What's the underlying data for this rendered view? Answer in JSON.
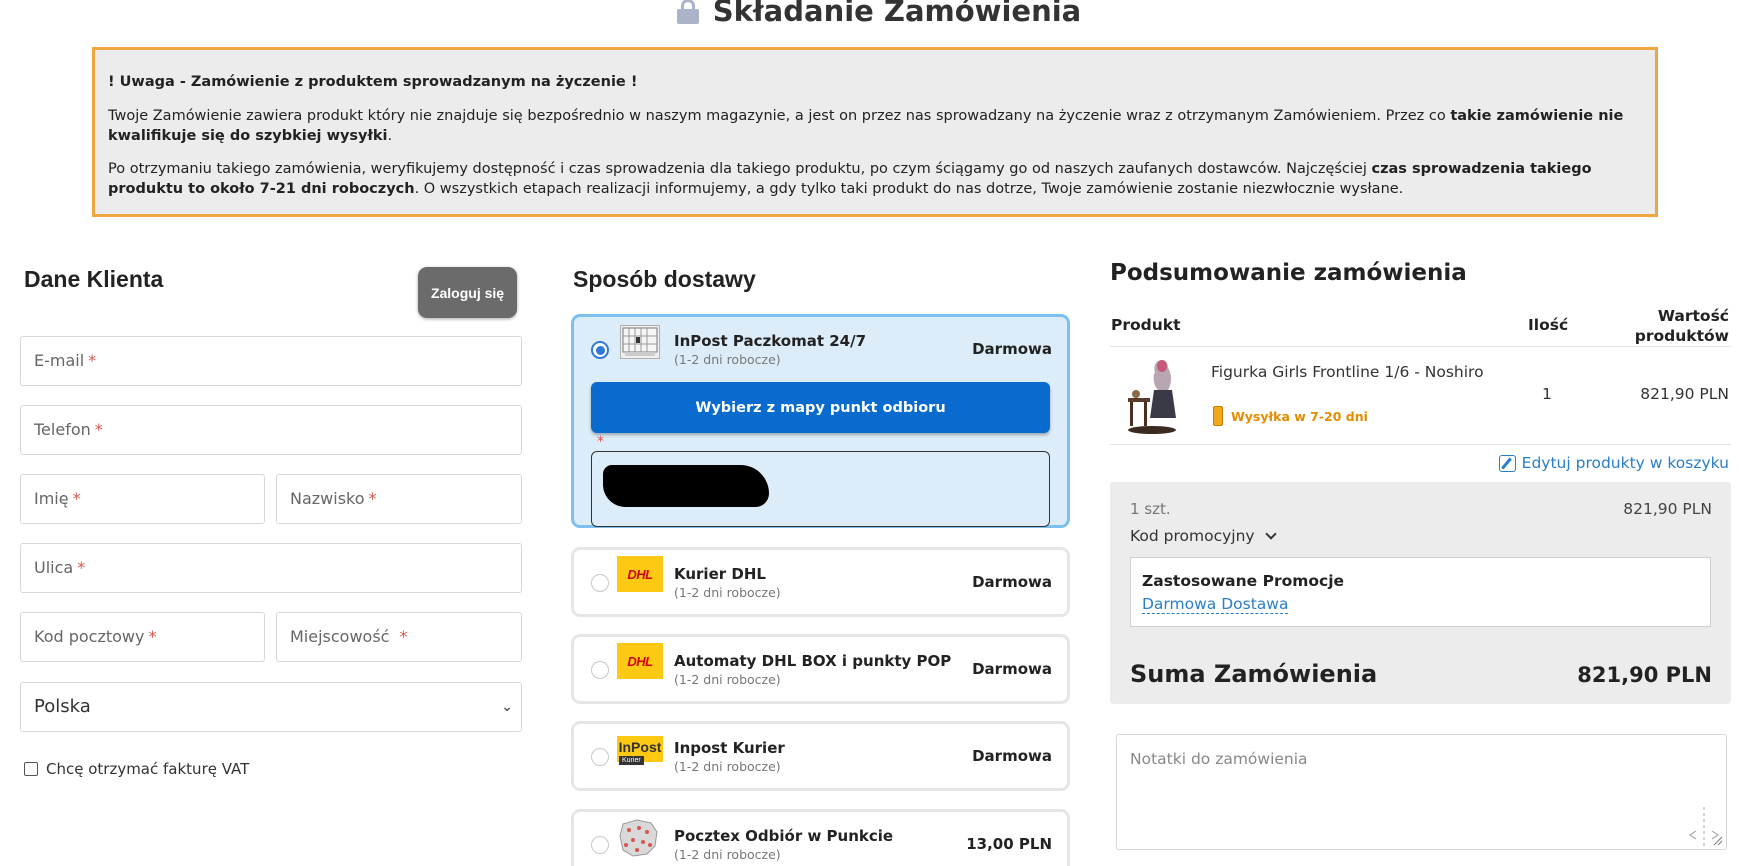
{
  "page": {
    "title": "Składanie Zamówienia"
  },
  "notice": {
    "heading": "! Uwaga - Zamówienie z produktem sprowadzanym na życzenie !",
    "p1_text": "Twoje Zamówienie zawiera produkt który nie znajduje się bezpośrednio w naszym magazynie, a jest on przez nas sprowadzany na życzenie wraz z otrzymanym Zamówieniem. Przez co ",
    "p1_bold": "takie zamówienie nie kwalifikuje się do szybkiej wysyłki",
    "p1_end": ".",
    "p2_text": "Po otrzymaniu takiego zamówienia, weryfikujemy dostępność i czas sprowadzenia dla takiego produktu, po czym ściągamy go od naszych zaufanych dostawców. Najczęściej ",
    "p2_bold": "czas sprowadzenia takiego produktu to około 7-21 dni roboczych",
    "p2_end": ". O wszystkich etapach realizacji informujemy, a gdy tylko taki produkt do nas dotrze, Twoje zamówienie zostanie niezwłocznie wysłane."
  },
  "customer": {
    "title": "Dane Klienta",
    "login_label": "Zaloguj się",
    "required_mark": "*",
    "fields": {
      "email": "E-mail",
      "phone": "Telefon",
      "first_name": "Imię",
      "last_name": "Nazwisko",
      "street": "Ulica",
      "postal_code": "Kod pocztowy",
      "city": "Miejscowość"
    },
    "country": "Polska",
    "vat_label": "Chcę otrzymać fakturę VAT"
  },
  "shipping": {
    "title": "Sposób dostawy",
    "map_button": "Wybierz z mapy punkt odbioru",
    "required_mark": "*",
    "options": [
      {
        "name": "InPost Paczkomat 24/7",
        "sub": "(1-2 dni robocze)",
        "price": "Darmowa",
        "selected": true,
        "icon": "parcel-locker-icon"
      },
      {
        "name": "Kurier DHL",
        "sub": "(1-2 dni robocze)",
        "price": "Darmowa",
        "selected": false,
        "icon": "dhl-logo"
      },
      {
        "name": "Automaty DHL BOX i punkty POP",
        "sub": "(1-2 dni robocze)",
        "price": "Darmowa",
        "selected": false,
        "icon": "dhl-logo"
      },
      {
        "name": "Inpost Kurier",
        "sub": "(1-2 dni robocze)",
        "price": "Darmowa",
        "selected": false,
        "icon": "inpost-kurier-logo"
      },
      {
        "name": "Pocztex Odbiór w Punkcie",
        "sub": "(1-2 dni robocze)",
        "price": "13,00 PLN",
        "selected": false,
        "icon": "pocztex-map-icon"
      }
    ],
    "logos": {
      "dhl": "DHL",
      "inpost": "InPost",
      "inpost_sub": "Kurier"
    }
  },
  "summary": {
    "title": "Podsumowanie zamówienia",
    "col_product": "Produkt",
    "col_qty": "Ilość",
    "col_value_line1": "Wartość",
    "col_value_line2": "produktów",
    "product": {
      "name": "Figurka Girls Frontline 1/6 - Noshiro",
      "shipping_note": "Wysyłka w 7-20 dni",
      "qty": "1",
      "value": "821,90 PLN"
    },
    "edit_link": "Edytuj produkty w koszyku",
    "items_count": "1 szt.",
    "subtotal": "821,90 PLN",
    "promo_toggle": "Kod promocyjny",
    "promo_title": "Zastosowane Promocje",
    "promo_item": "Darmowa Dostawa",
    "total_label": "Suma Zamówienia",
    "total_value": "821,90 PLN",
    "notes_placeholder": "Notatki do zamówienia"
  },
  "colors": {
    "accent_blue": "#0a6bcf",
    "notice_border": "#f0a640",
    "selected_bg": "#dcedf9",
    "required": "#d9534f",
    "shipping_note": "#e58c00"
  }
}
